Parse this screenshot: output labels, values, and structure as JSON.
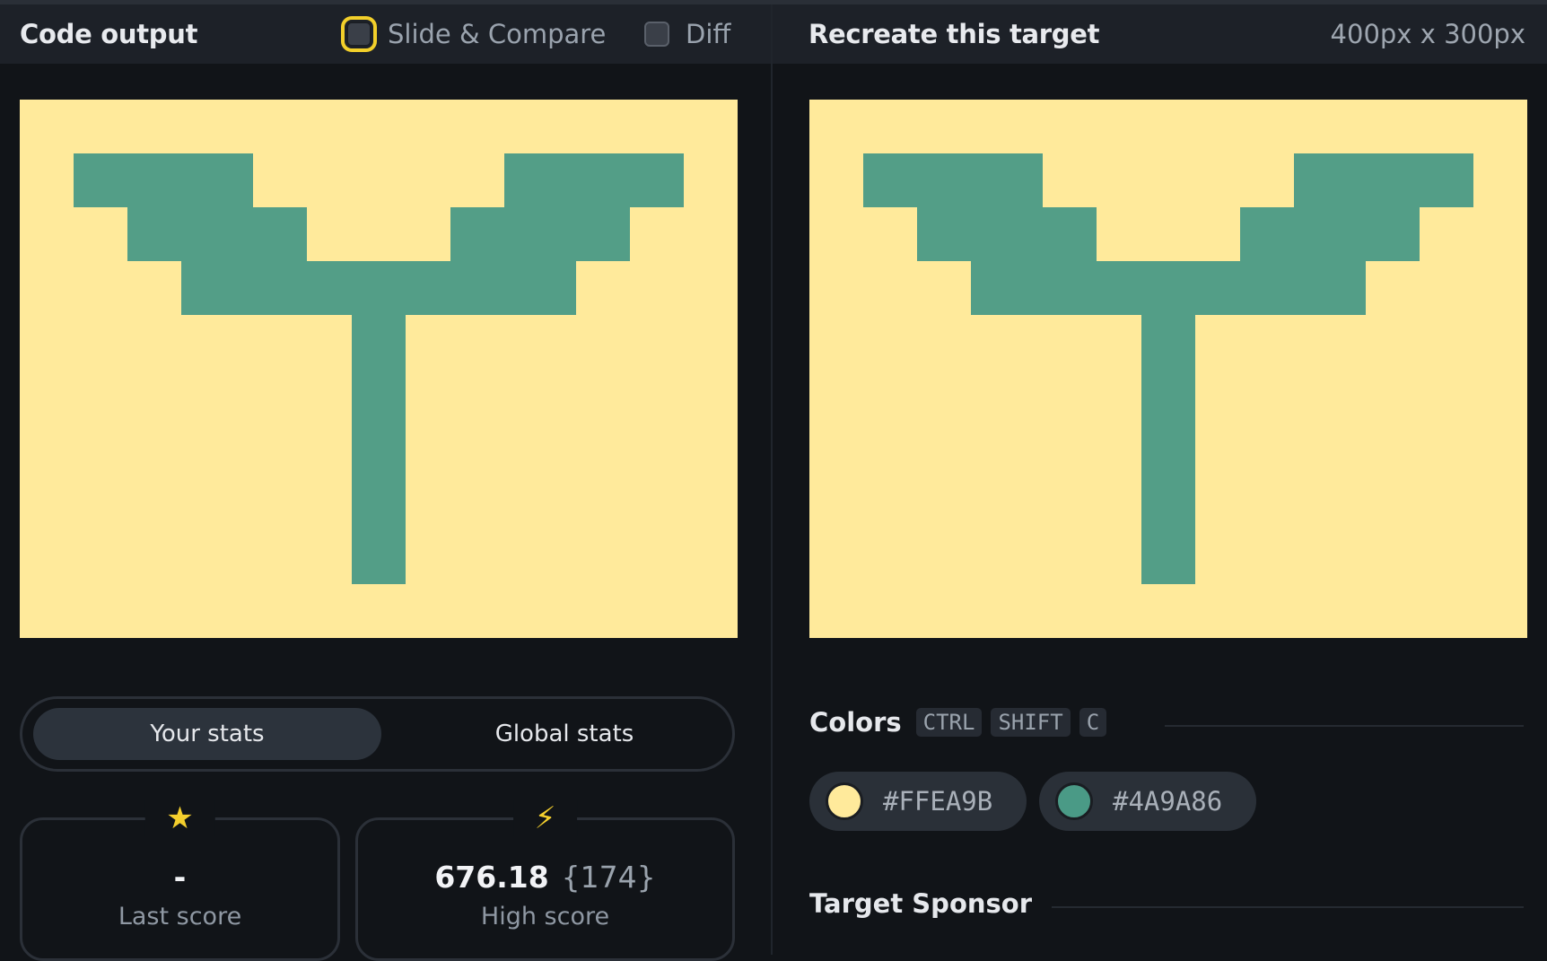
{
  "left": {
    "title": "Code output",
    "toggles": [
      {
        "label": "Slide & Compare",
        "checked": false
      },
      {
        "label": "Diff",
        "checked": false
      }
    ]
  },
  "right": {
    "title": "Recreate this target",
    "dimensions": "400px x 300px"
  },
  "stats": {
    "tabs": [
      "Your stats",
      "Global stats"
    ],
    "active_tab": "Your stats",
    "last": {
      "icon": "star-icon",
      "value": "-",
      "label": "Last score"
    },
    "high": {
      "icon": "lightning-icon",
      "value": "676.18",
      "extra": "{174}",
      "label": "High score"
    }
  },
  "colors": {
    "title": "Colors",
    "shortcut": [
      "CTRL",
      "SHIFT",
      "C"
    ],
    "swatches": [
      {
        "hex": "#FFEA9B"
      },
      {
        "hex": "#4A9A86"
      }
    ]
  },
  "sponsor": {
    "title": "Target Sponsor"
  }
}
